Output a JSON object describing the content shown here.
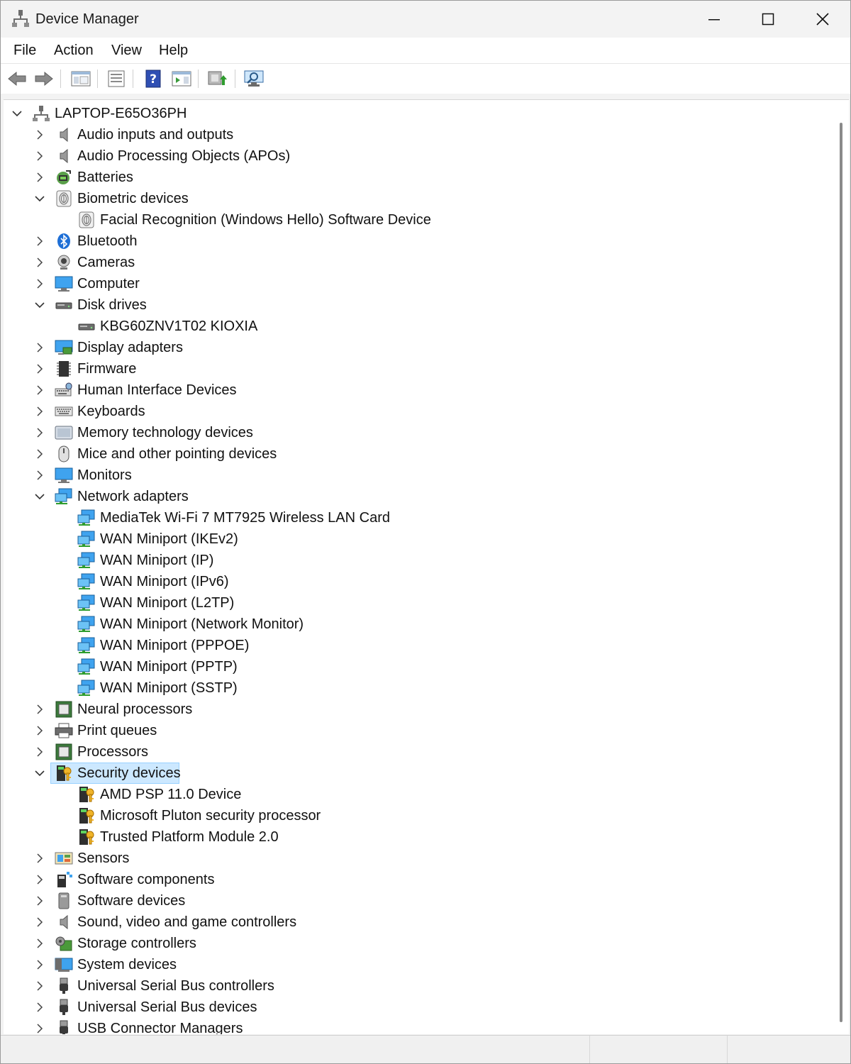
{
  "window": {
    "title": "Device Manager",
    "app_icon": "device-manager-icon"
  },
  "menu": {
    "items": [
      "File",
      "Action",
      "View",
      "Help"
    ]
  },
  "toolbar": {
    "buttons": [
      "back-arrow-icon",
      "forward-arrow-icon",
      "show-hide-console-tree-icon",
      "properties-icon",
      "help-icon",
      "action-pane-icon",
      "update-driver-icon",
      "scan-hardware-icon"
    ]
  },
  "tree": {
    "root": "LAPTOP-E65O36PH",
    "nodes": [
      {
        "label": "Audio inputs and outputs",
        "icon": "speaker-icon",
        "level": 1,
        "expanded": false
      },
      {
        "label": "Audio Processing Objects (APOs)",
        "icon": "speaker-icon",
        "level": 1,
        "expanded": false
      },
      {
        "label": "Batteries",
        "icon": "battery-icon",
        "level": 1,
        "expanded": false
      },
      {
        "label": "Biometric devices",
        "icon": "fingerprint-icon",
        "level": 1,
        "expanded": true
      },
      {
        "label": "Facial Recognition (Windows Hello) Software Device",
        "icon": "fingerprint-icon",
        "level": 2
      },
      {
        "label": "Bluetooth",
        "icon": "bluetooth-icon",
        "level": 1,
        "expanded": false
      },
      {
        "label": "Cameras",
        "icon": "camera-icon",
        "level": 1,
        "expanded": false
      },
      {
        "label": "Computer",
        "icon": "computer-icon",
        "level": 1,
        "expanded": false
      },
      {
        "label": "Disk drives",
        "icon": "disk-drive-icon",
        "level": 1,
        "expanded": true
      },
      {
        "label": "KBG60ZNV1T02 KIOXIA",
        "icon": "disk-drive-icon",
        "level": 2
      },
      {
        "label": "Display adapters",
        "icon": "display-adapter-icon",
        "level": 1,
        "expanded": false
      },
      {
        "label": "Firmware",
        "icon": "firmware-icon",
        "level": 1,
        "expanded": false
      },
      {
        "label": "Human Interface Devices",
        "icon": "hid-icon",
        "level": 1,
        "expanded": false
      },
      {
        "label": "Keyboards",
        "icon": "keyboard-icon",
        "level": 1,
        "expanded": false
      },
      {
        "label": "Memory technology devices",
        "icon": "memory-device-icon",
        "level": 1,
        "expanded": false
      },
      {
        "label": "Mice and other pointing devices",
        "icon": "mouse-icon",
        "level": 1,
        "expanded": false
      },
      {
        "label": "Monitors",
        "icon": "monitor-icon",
        "level": 1,
        "expanded": false
      },
      {
        "label": "Network adapters",
        "icon": "network-adapter-icon",
        "level": 1,
        "expanded": true
      },
      {
        "label": "MediaTek Wi-Fi 7 MT7925 Wireless LAN Card",
        "icon": "network-adapter-icon",
        "level": 2
      },
      {
        "label": "WAN Miniport (IKEv2)",
        "icon": "network-adapter-icon",
        "level": 2
      },
      {
        "label": "WAN Miniport (IP)",
        "icon": "network-adapter-icon",
        "level": 2
      },
      {
        "label": "WAN Miniport (IPv6)",
        "icon": "network-adapter-icon",
        "level": 2
      },
      {
        "label": "WAN Miniport (L2TP)",
        "icon": "network-adapter-icon",
        "level": 2
      },
      {
        "label": "WAN Miniport (Network Monitor)",
        "icon": "network-adapter-icon",
        "level": 2
      },
      {
        "label": "WAN Miniport (PPPOE)",
        "icon": "network-adapter-icon",
        "level": 2
      },
      {
        "label": "WAN Miniport (PPTP)",
        "icon": "network-adapter-icon",
        "level": 2
      },
      {
        "label": "WAN Miniport (SSTP)",
        "icon": "network-adapter-icon",
        "level": 2
      },
      {
        "label": "Neural processors",
        "icon": "processor-icon",
        "level": 1,
        "expanded": false
      },
      {
        "label": "Print queues",
        "icon": "printer-icon",
        "level": 1,
        "expanded": false
      },
      {
        "label": "Processors",
        "icon": "processor-icon",
        "level": 1,
        "expanded": false
      },
      {
        "label": "Security devices",
        "icon": "security-key-icon",
        "level": 1,
        "expanded": true,
        "selected": true
      },
      {
        "label": "AMD PSP 11.0 Device",
        "icon": "security-key-icon",
        "level": 2
      },
      {
        "label": "Microsoft Pluton security processor",
        "icon": "security-key-icon",
        "level": 2
      },
      {
        "label": "Trusted Platform Module 2.0",
        "icon": "security-key-icon",
        "level": 2
      },
      {
        "label": "Sensors",
        "icon": "sensor-icon",
        "level": 1,
        "expanded": false
      },
      {
        "label": "Software components",
        "icon": "software-component-icon",
        "level": 1,
        "expanded": false
      },
      {
        "label": "Software devices",
        "icon": "software-device-icon",
        "level": 1,
        "expanded": false
      },
      {
        "label": "Sound, video and game controllers",
        "icon": "speaker-icon",
        "level": 1,
        "expanded": false
      },
      {
        "label": "Storage controllers",
        "icon": "storage-controller-icon",
        "level": 1,
        "expanded": false
      },
      {
        "label": "System devices",
        "icon": "system-device-icon",
        "level": 1,
        "expanded": false
      },
      {
        "label": "Universal Serial Bus controllers",
        "icon": "usb-icon",
        "level": 1,
        "expanded": false
      },
      {
        "label": "Universal Serial Bus devices",
        "icon": "usb-icon",
        "level": 1,
        "expanded": false
      },
      {
        "label": "USB Connector Managers",
        "icon": "usb-icon",
        "level": 1,
        "expanded": false
      }
    ]
  },
  "colors": {
    "selection_bg": "#cce8ff",
    "selection_border": "#99d1ff",
    "accent": "#0078d4"
  }
}
